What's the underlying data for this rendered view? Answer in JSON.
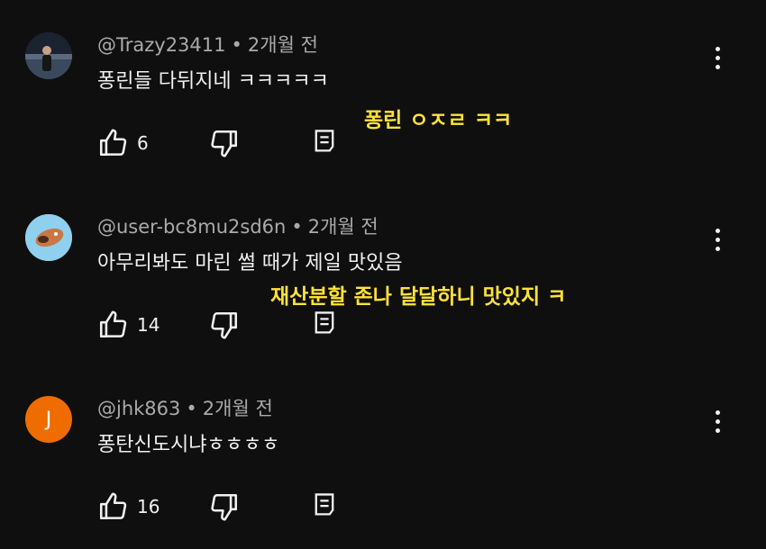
{
  "comments": [
    {
      "author": "@Trazy23411",
      "time": "2개월 전",
      "text": "퐁린들 다뒤지네 ㅋㅋㅋㅋㅋ",
      "likes": "6",
      "overlay": "퐁린 ㅇㅈㄹ ㅋㅋ",
      "avatar": "photo"
    },
    {
      "author": "@user-bc8mu2sd6n",
      "time": "2개월 전",
      "text": "아무리봐도 마린 썰 때가 제일 맛있음",
      "likes": "14",
      "overlay": "재산분할 존나 달달하니 맛있지 ㅋ",
      "avatar": "illustration"
    },
    {
      "author": "@jhk863",
      "time": "2개월 전",
      "text": "퐁탄신도시냐ㅎㅎㅎㅎ",
      "likes": "16",
      "avatar_letter": "J",
      "avatar_color": "#ef6c00"
    }
  ]
}
